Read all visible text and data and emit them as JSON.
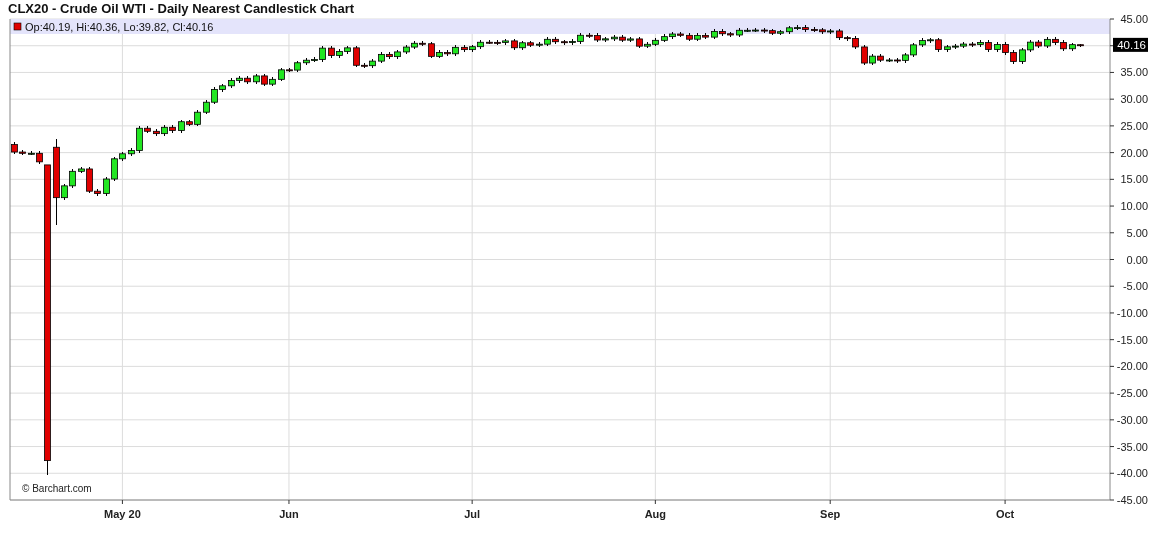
{
  "title": "CLX20 - Crude Oil WTI - Daily Nearest Candlestick Chart",
  "chart": {
    "legend": "Op:40.19, Hi:40.36, Lo:39.82, Cl:40.16",
    "last_price": "40.16",
    "credit": "© Barchart.com",
    "chart_data": {
      "type": "candlestick",
      "ylim": [
        -45,
        45
      ],
      "categories": [
        null,
        null,
        null,
        null,
        null,
        null,
        null,
        null,
        null,
        null,
        null,
        null,
        null,
        "May 20",
        null,
        null,
        null,
        null,
        null,
        null,
        null,
        null,
        null,
        null,
        null,
        null,
        null,
        null,
        null,
        null,
        null,
        null,
        null,
        "Jun",
        null,
        null,
        null,
        null,
        null,
        null,
        null,
        null,
        null,
        null,
        null,
        null,
        null,
        null,
        null,
        null,
        null,
        null,
        null,
        null,
        null,
        "Jul",
        null,
        null,
        null,
        null,
        null,
        null,
        null,
        null,
        null,
        null,
        null,
        null,
        null,
        null,
        null,
        null,
        null,
        null,
        null,
        null,
        null,
        "Aug",
        null,
        null,
        null,
        null,
        null,
        null,
        null,
        null,
        null,
        null,
        null,
        null,
        null,
        null,
        null,
        null,
        null,
        null,
        null,
        null,
        "Sep",
        null,
        null,
        null,
        null,
        null,
        null,
        null,
        null,
        null,
        null,
        null,
        null,
        null,
        null,
        null,
        null,
        null,
        null,
        null,
        null,
        "Oct",
        null,
        null,
        null,
        null,
        null,
        null,
        null,
        null,
        null
      ],
      "ohlc": [
        [
          21.5,
          21.9,
          19.71,
          20.11
        ],
        [
          20.11,
          20.51,
          19.47,
          19.87
        ],
        [
          19.87,
          20.27,
          19.47,
          19.87
        ],
        [
          19.87,
          20.27,
          17.87,
          18.27
        ],
        [
          17.7,
          17.7,
          -40.32,
          -37.63
        ],
        [
          21.0,
          22.5,
          6.5,
          11.57
        ],
        [
          11.57,
          14.18,
          11.17,
          13.78
        ],
        [
          13.78,
          16.9,
          13.38,
          16.5
        ],
        [
          16.5,
          17.34,
          16.1,
          16.94
        ],
        [
          16.94,
          17.34,
          12.38,
          12.78
        ],
        [
          12.78,
          13.18,
          11.94,
          12.34
        ],
        [
          12.34,
          15.46,
          11.94,
          15.06
        ],
        [
          15.06,
          19.24,
          14.66,
          18.84
        ],
        [
          18.84,
          20.18,
          18.44,
          19.78
        ],
        [
          19.78,
          20.79,
          19.38,
          20.39
        ],
        [
          20.39,
          24.96,
          19.99,
          24.56
        ],
        [
          24.56,
          24.96,
          23.59,
          23.99
        ],
        [
          23.99,
          24.39,
          23.15,
          23.55
        ],
        [
          23.55,
          25.14,
          23.15,
          24.74
        ],
        [
          24.74,
          25.14,
          23.74,
          24.14
        ],
        [
          24.14,
          26.18,
          23.74,
          25.78
        ],
        [
          25.78,
          26.18,
          24.89,
          25.29
        ],
        [
          25.29,
          27.96,
          24.89,
          27.56
        ],
        [
          27.56,
          29.83,
          27.16,
          29.43
        ],
        [
          29.43,
          32.22,
          29.03,
          31.82
        ],
        [
          31.82,
          32.9,
          31.42,
          32.5
        ],
        [
          32.5,
          33.89,
          32.1,
          33.49
        ],
        [
          33.49,
          34.32,
          33.09,
          33.92
        ],
        [
          33.92,
          34.32,
          32.85,
          33.25
        ],
        [
          33.25,
          34.75,
          32.85,
          34.35
        ],
        [
          34.35,
          34.75,
          32.41,
          32.81
        ],
        [
          32.81,
          34.11,
          32.41,
          33.71
        ],
        [
          33.71,
          35.89,
          33.31,
          35.49
        ],
        [
          35.49,
          35.89,
          35.04,
          35.44
        ],
        [
          35.44,
          37.21,
          35.04,
          36.81
        ],
        [
          36.81,
          37.69,
          36.41,
          37.29
        ],
        [
          37.29,
          37.81,
          36.89,
          37.41
        ],
        [
          37.41,
          39.95,
          37.01,
          39.55
        ],
        [
          39.55,
          39.95,
          37.79,
          38.19
        ],
        [
          38.19,
          39.34,
          37.79,
          38.94
        ],
        [
          38.94,
          40.0,
          38.54,
          39.6
        ],
        [
          39.6,
          40.0,
          35.94,
          36.34
        ],
        [
          36.34,
          36.74,
          35.86,
          36.26
        ],
        [
          36.26,
          37.52,
          35.86,
          37.12
        ],
        [
          37.12,
          38.78,
          36.72,
          38.38
        ],
        [
          38.38,
          38.78,
          37.56,
          37.96
        ],
        [
          37.96,
          39.24,
          37.56,
          38.84
        ],
        [
          38.84,
          40.15,
          38.44,
          39.75
        ],
        [
          39.75,
          40.86,
          39.35,
          40.46
        ],
        [
          40.46,
          40.86,
          39.97,
          40.37
        ],
        [
          40.37,
          40.77,
          37.61,
          38.01
        ],
        [
          38.01,
          39.12,
          37.61,
          38.72
        ],
        [
          38.72,
          39.12,
          38.09,
          38.49
        ],
        [
          38.49,
          40.1,
          38.09,
          39.7
        ],
        [
          39.7,
          40.1,
          38.87,
          39.27
        ],
        [
          39.27,
          40.22,
          38.87,
          39.82
        ],
        [
          39.82,
          41.05,
          39.42,
          40.65
        ],
        [
          40.65,
          41.05,
          40.23,
          40.63
        ],
        [
          40.63,
          41.03,
          40.22,
          40.62
        ],
        [
          40.62,
          41.3,
          40.22,
          40.9
        ],
        [
          40.9,
          41.3,
          39.22,
          39.62
        ],
        [
          39.62,
          40.95,
          39.22,
          40.55
        ],
        [
          40.55,
          40.95,
          39.7,
          40.1
        ],
        [
          40.1,
          40.69,
          39.7,
          40.29
        ],
        [
          40.29,
          41.6,
          39.89,
          41.2
        ],
        [
          41.2,
          41.6,
          40.35,
          40.75
        ],
        [
          40.75,
          41.15,
          40.19,
          40.59
        ],
        [
          40.59,
          41.21,
          40.19,
          40.81
        ],
        [
          40.81,
          42.36,
          40.41,
          41.96
        ],
        [
          41.96,
          42.36,
          41.5,
          41.9
        ],
        [
          41.9,
          42.3,
          40.67,
          41.07
        ],
        [
          41.07,
          41.69,
          40.67,
          41.29
        ],
        [
          41.29,
          42.0,
          40.89,
          41.6
        ],
        [
          41.6,
          42.0,
          40.64,
          41.04
        ],
        [
          41.04,
          41.67,
          40.64,
          41.27
        ],
        [
          41.27,
          41.67,
          39.52,
          39.92
        ],
        [
          39.92,
          40.67,
          39.52,
          40.27
        ],
        [
          40.27,
          41.41,
          39.87,
          41.01
        ],
        [
          41.01,
          42.1,
          40.61,
          41.7
        ],
        [
          41.7,
          42.59,
          41.3,
          42.19
        ],
        [
          42.19,
          42.59,
          41.55,
          41.95
        ],
        [
          41.95,
          42.35,
          40.82,
          41.22
        ],
        [
          41.22,
          42.34,
          40.82,
          41.94
        ],
        [
          41.94,
          42.34,
          41.21,
          41.61
        ],
        [
          41.61,
          43.07,
          41.21,
          42.67
        ],
        [
          42.67,
          43.07,
          41.84,
          42.24
        ],
        [
          42.24,
          42.64,
          41.61,
          42.01
        ],
        [
          42.01,
          43.29,
          41.61,
          42.89
        ],
        [
          42.89,
          43.29,
          42.49,
          42.89
        ],
        [
          42.89,
          43.33,
          42.49,
          42.93
        ],
        [
          42.93,
          43.33,
          42.42,
          42.82
        ],
        [
          42.82,
          43.22,
          41.94,
          42.34
        ],
        [
          42.34,
          43.02,
          41.94,
          42.62
        ],
        [
          42.62,
          43.75,
          42.22,
          43.35
        ],
        [
          43.35,
          43.79,
          42.95,
          43.39
        ],
        [
          43.39,
          43.79,
          42.64,
          43.04
        ],
        [
          43.04,
          43.44,
          42.57,
          42.97
        ],
        [
          42.97,
          43.37,
          42.21,
          42.61
        ],
        [
          42.61,
          43.16,
          42.21,
          42.76
        ],
        [
          42.76,
          43.16,
          41.11,
          41.51
        ],
        [
          41.51,
          41.91,
          40.97,
          41.37
        ],
        [
          41.37,
          41.77,
          39.37,
          39.77
        ],
        [
          39.77,
          40.17,
          36.36,
          36.76
        ],
        [
          36.76,
          38.45,
          36.36,
          38.05
        ],
        [
          38.05,
          38.45,
          36.9,
          37.3
        ],
        [
          37.3,
          37.73,
          36.9,
          37.33
        ],
        [
          37.33,
          37.73,
          36.86,
          37.26
        ],
        [
          37.26,
          38.68,
          36.86,
          38.28
        ],
        [
          38.28,
          40.56,
          37.88,
          40.16
        ],
        [
          40.16,
          41.37,
          39.76,
          40.97
        ],
        [
          40.97,
          41.51,
          40.57,
          41.11
        ],
        [
          41.11,
          41.51,
          38.91,
          39.31
        ],
        [
          39.31,
          40.2,
          38.91,
          39.8
        ],
        [
          39.8,
          40.33,
          39.4,
          39.93
        ],
        [
          39.93,
          40.71,
          39.53,
          40.31
        ],
        [
          40.31,
          40.71,
          39.85,
          40.25
        ],
        [
          40.25,
          41.0,
          39.85,
          40.6
        ],
        [
          40.6,
          41.0,
          38.89,
          39.29
        ],
        [
          39.29,
          40.62,
          38.89,
          40.22
        ],
        [
          40.22,
          40.62,
          38.32,
          38.72
        ],
        [
          38.72,
          39.12,
          36.65,
          37.05
        ],
        [
          37.05,
          39.62,
          36.65,
          39.22
        ],
        [
          39.22,
          41.07,
          38.82,
          40.67
        ],
        [
          40.67,
          41.07,
          39.55,
          39.95
        ],
        [
          39.95,
          41.59,
          39.55,
          41.19
        ],
        [
          41.19,
          41.59,
          40.2,
          40.6
        ],
        [
          40.6,
          41.0,
          39.03,
          39.43
        ],
        [
          39.43,
          40.6,
          39.03,
          40.2
        ],
        [
          40.19,
          40.36,
          39.82,
          40.16
        ]
      ],
      "yticks": [
        {
          "value": 45,
          "label": "45.00"
        },
        {
          "value": 35,
          "label": "35.00"
        },
        {
          "value": 30,
          "label": "30.00"
        },
        {
          "value": 25,
          "label": "25.00"
        },
        {
          "value": 20,
          "label": "20.00"
        },
        {
          "value": 15,
          "label": "15.00"
        },
        {
          "value": 10,
          "label": "10.00"
        },
        {
          "value": 5,
          "label": "5.00"
        },
        {
          "value": 0,
          "label": "0.00"
        },
        {
          "value": -5,
          "label": "-5.00"
        },
        {
          "value": -10,
          "label": "-10.00"
        },
        {
          "value": -15,
          "label": "-15.00"
        },
        {
          "value": -20,
          "label": "-20.00"
        },
        {
          "value": -25,
          "label": "-25.00"
        },
        {
          "value": -30,
          "label": "-30.00"
        },
        {
          "value": -35,
          "label": "-35.00"
        },
        {
          "value": -40,
          "label": "-40.00"
        },
        {
          "value": -45,
          "label": "-45.00"
        }
      ],
      "grid": true
    }
  }
}
